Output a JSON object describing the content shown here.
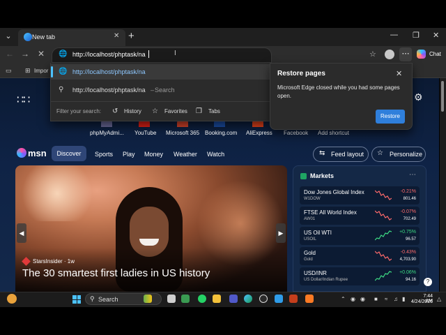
{
  "browser": {
    "tab_title": "New tab",
    "address_value": "http://localhost/phptask/na",
    "chat_label": "Chat",
    "favorites_import_label": "Impor"
  },
  "autocomplete": {
    "suggestion_url": "http://localhost/phptask/na",
    "search_query": "http://localhost/phptask/na",
    "search_separator": "–",
    "search_label": "Search",
    "filter_label": "Filter your search:",
    "filters": [
      {
        "label": "History",
        "icon": "history-icon"
      },
      {
        "label": "Favorites",
        "icon": "star-icon"
      },
      {
        "label": "Tabs",
        "icon": "tabs-icon"
      }
    ]
  },
  "restore": {
    "title": "Restore pages",
    "body": "Microsoft Edge closed while you had some pages open.",
    "button": "Restore"
  },
  "quick_links": [
    {
      "label": "phpMyAdmi...",
      "color": "#6c6c9c"
    },
    {
      "label": "YouTube",
      "color": "#e62117"
    },
    {
      "label": "Microsoft 365",
      "color": "#d9452b"
    },
    {
      "label": "Booking.com",
      "color": "#1b4fa8"
    },
    {
      "label": "AliExpress",
      "color": "#e8431c"
    },
    {
      "label": "Facebook",
      "color": ""
    },
    {
      "label": "Add shortcut",
      "color": ""
    }
  ],
  "msn": {
    "logo": "msn",
    "tabs": [
      "Discover",
      "Sports",
      "Play",
      "Money",
      "Weather",
      "Watch"
    ],
    "feed_layout": "Feed layout",
    "personalize": "Personalize"
  },
  "hero": {
    "source": "StarsInsider",
    "age": "· 1w",
    "headline": "The 30 smartest first ladies in US history"
  },
  "markets": {
    "title": "Markets",
    "items": [
      {
        "name": "Dow Jones Global Index",
        "symbol": "W1DOW",
        "change": "-0.21%",
        "value": "801.46",
        "trend": "down"
      },
      {
        "name": "FTSE All World Index",
        "symbol": "AW01",
        "change": "-0.07%",
        "value": "702.49",
        "trend": "down"
      },
      {
        "name": "US Oil WTI",
        "symbol": "USOIL",
        "change": "+0.75%",
        "value": "96.57",
        "trend": "up"
      },
      {
        "name": "Gold",
        "symbol": "Gold",
        "change": "-0.43%",
        "value": "4,703.90",
        "trend": "down"
      },
      {
        "name": "USD/INR",
        "symbol": "US Dollar/Indian Rupee",
        "change": "+0.06%",
        "value": "94.16",
        "trend": "up"
      }
    ]
  },
  "taskbar": {
    "search_label": "Search",
    "time": "7:44 AM",
    "date": "4/24/2026"
  },
  "colors": {
    "accent": "#4cc2ff",
    "positive": "#3ddc84",
    "negative": "#ff6b6b",
    "restore_button": "#2f7fdb"
  }
}
